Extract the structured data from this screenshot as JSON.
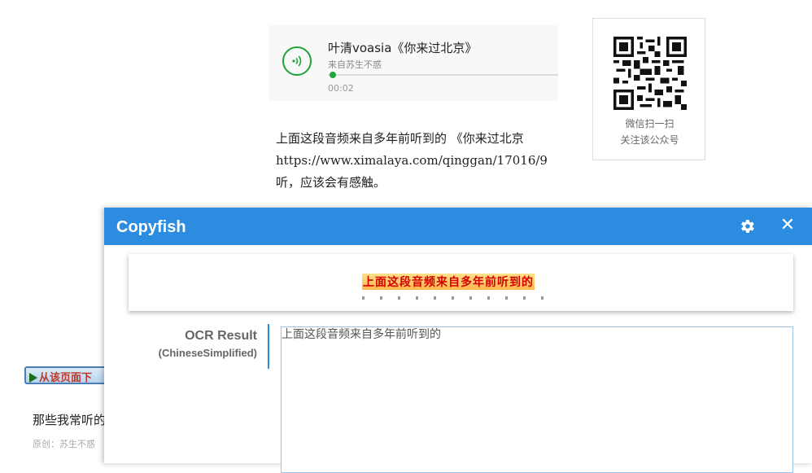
{
  "audio": {
    "title": "叶清voasia《你来过北京》",
    "subtitle": "来自苏生不惑",
    "time": "00:02",
    "progress": 0.02,
    "accent": "#22a33a"
  },
  "article": {
    "line1": "上面这段音频来自多年前听到的 《你来过北京",
    "line2": "https://www.ximalaya.com/qinggan/17016/9",
    "line3": "听，应该会有感触。"
  },
  "qr": {
    "caption1": "微信扫一扫",
    "caption2": "关注该公众号"
  },
  "download_banner": {
    "text": "从该页面下"
  },
  "list": {
    "title": "那些我常听的",
    "meta": "原创：苏生不惑"
  },
  "copyfish": {
    "title": "Copyfish",
    "header_color": "#2c8de0",
    "gear_icon": "gear-icon",
    "close_icon": "close-icon",
    "preview_text": "上面这段音频来自多年前听到的",
    "ocr_label": "OCR Result",
    "language": "(ChineseSimplified)",
    "ocr_text": "上面这段音频来自多年前听到的"
  }
}
